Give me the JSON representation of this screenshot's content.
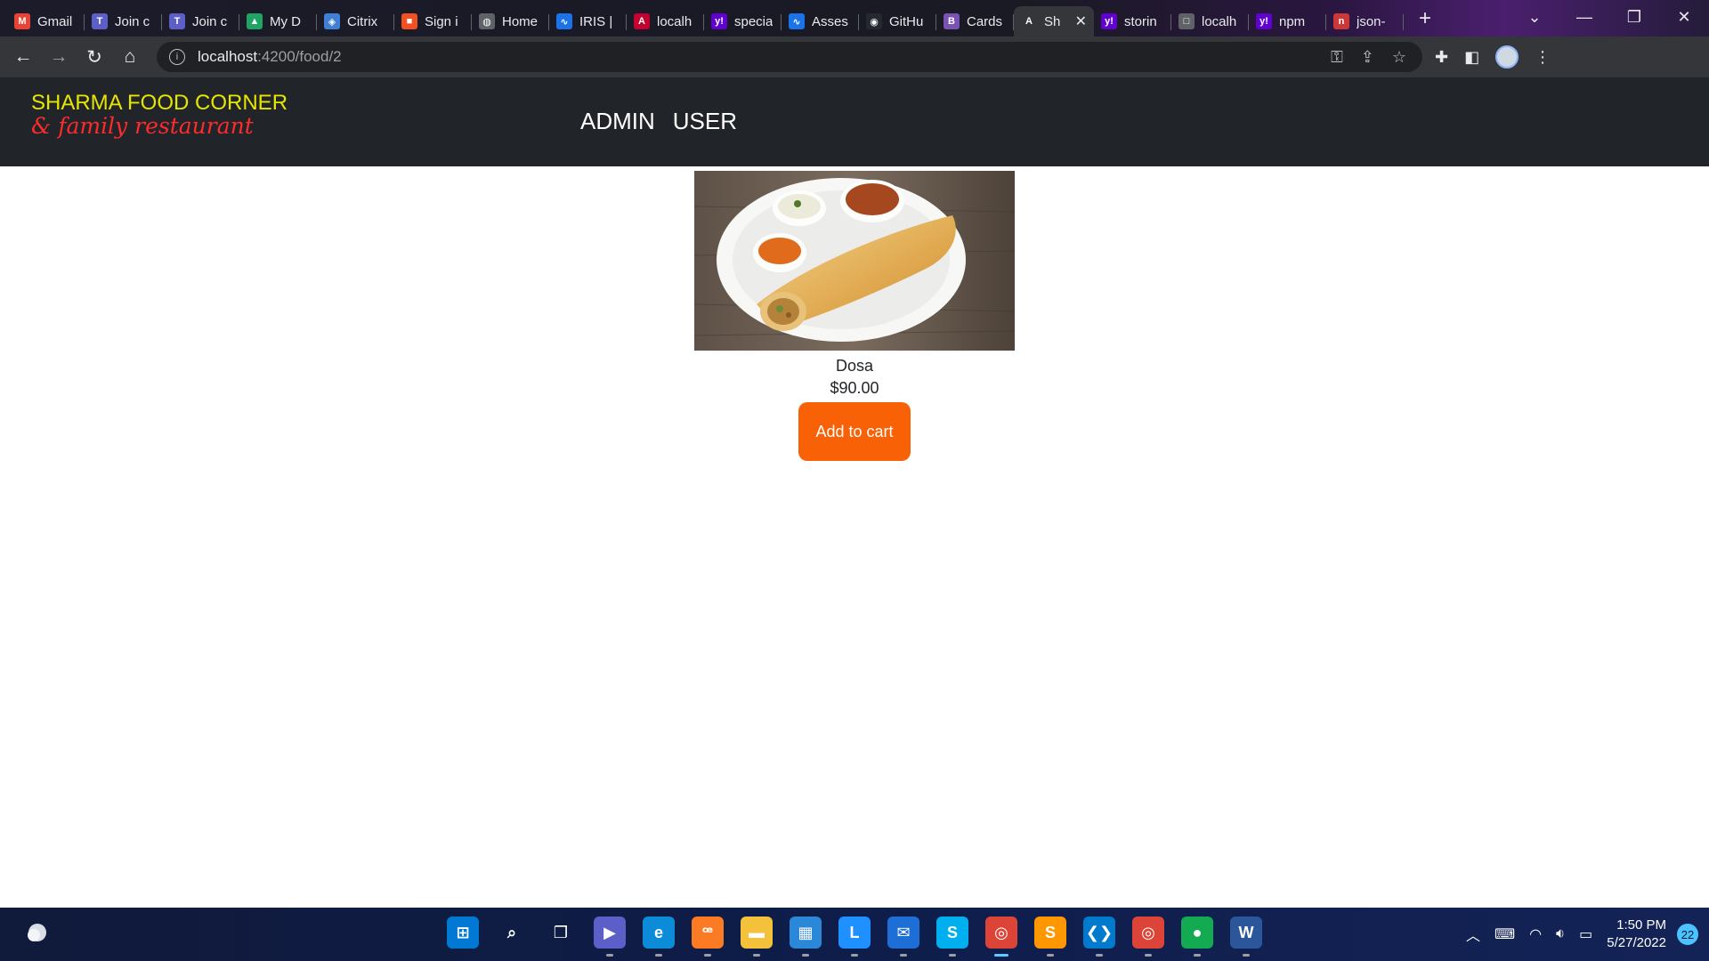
{
  "browser": {
    "tabs": [
      {
        "title": "Gmail",
        "icon": "gmail-icon",
        "color": "#ea4335",
        "glyph": "M"
      },
      {
        "title": "Join c",
        "icon": "teams-icon",
        "color": "#5b5fc7",
        "glyph": "T"
      },
      {
        "title": "Join c",
        "icon": "teams-icon",
        "color": "#5b5fc7",
        "glyph": "T"
      },
      {
        "title": "My D",
        "icon": "drive-icon",
        "color": "#1fa463",
        "glyph": "▲"
      },
      {
        "title": "Citrix",
        "icon": "citrix-icon",
        "color": "#3f7fd6",
        "glyph": "◈"
      },
      {
        "title": "Sign i",
        "icon": "microsoft-icon",
        "color": "#f25022",
        "glyph": "■"
      },
      {
        "title": "Home",
        "icon": "globe-icon",
        "color": "#5f6368",
        "glyph": "◍"
      },
      {
        "title": "IRIS |",
        "icon": "iris-icon",
        "color": "#1a73e8",
        "glyph": "∿"
      },
      {
        "title": "localh",
        "icon": "angular-icon",
        "color": "#c3002f",
        "glyph": "A"
      },
      {
        "title": "specia",
        "icon": "yahoo-icon",
        "color": "#6001d2",
        "glyph": "y!"
      },
      {
        "title": "Asses",
        "icon": "iris-icon",
        "color": "#1a73e8",
        "glyph": "∿"
      },
      {
        "title": "GitHu",
        "icon": "github-icon",
        "color": "#24292f",
        "glyph": "◉"
      },
      {
        "title": "Cards",
        "icon": "bootstrap-icon",
        "color": "#7952b3",
        "glyph": "B"
      },
      {
        "title": "Sh",
        "icon": "angular-icon",
        "color": "#35363a",
        "glyph": "A",
        "active": true
      },
      {
        "title": "storin",
        "icon": "yahoo-icon",
        "color": "#6001d2",
        "glyph": "y!"
      },
      {
        "title": "localh",
        "icon": "page-icon",
        "color": "#5f6368",
        "glyph": "□"
      },
      {
        "title": "npm",
        "icon": "yahoo-icon",
        "color": "#6001d2",
        "glyph": "y!"
      },
      {
        "title": "json-",
        "icon": "npm-icon",
        "color": "#cb3837",
        "glyph": "n"
      }
    ],
    "new_tab": "+",
    "address": {
      "host": "localhost",
      "path": ":4200/food/2"
    }
  },
  "app": {
    "brand_line1": "SHARMA FOOD CORNER",
    "brand_line2": "& family restaurant",
    "nav": {
      "admin": "ADMIN",
      "user": "USER"
    }
  },
  "food": {
    "name": "Dosa",
    "price": "$90.00",
    "add_to_cart": "Add to cart"
  },
  "taskbar": {
    "apps": [
      {
        "name": "start-icon",
        "color": "#0078d4",
        "glyph": "⊞"
      },
      {
        "name": "search-icon",
        "color": "transparent",
        "glyph": "⌕"
      },
      {
        "name": "task-view-icon",
        "color": "transparent",
        "glyph": "❐"
      },
      {
        "name": "chat-icon",
        "color": "#5b5fc7",
        "glyph": "▶"
      },
      {
        "name": "edge-icon",
        "color": "#0c8bd9",
        "glyph": "e"
      },
      {
        "name": "xampp-icon",
        "color": "#fb7a24",
        "glyph": "ꟹ"
      },
      {
        "name": "file-explorer-icon",
        "color": "#f3c13a",
        "glyph": "▬"
      },
      {
        "name": "store-icon",
        "color": "#2b88d8",
        "glyph": "▦"
      },
      {
        "name": "l-app-icon",
        "color": "#1e90ff",
        "glyph": "L"
      },
      {
        "name": "mail-icon",
        "color": "#1d6fd6",
        "glyph": "✉"
      },
      {
        "name": "skype-icon",
        "color": "#00aff0",
        "glyph": "S"
      },
      {
        "name": "chrome-icon",
        "color": "#db4437",
        "glyph": "◎",
        "active": true
      },
      {
        "name": "sublime-icon",
        "color": "#ff9800",
        "glyph": "S"
      },
      {
        "name": "vscode-icon",
        "color": "#007acc",
        "glyph": "❮❯"
      },
      {
        "name": "chrome-icon",
        "color": "#db4437",
        "glyph": "◎"
      },
      {
        "name": "mongodb-icon",
        "color": "#13aa52",
        "glyph": "●"
      },
      {
        "name": "word-icon",
        "color": "#2b579a",
        "glyph": "W"
      }
    ],
    "time": "1:50 PM",
    "date": "5/27/2022",
    "notifications": "22"
  }
}
